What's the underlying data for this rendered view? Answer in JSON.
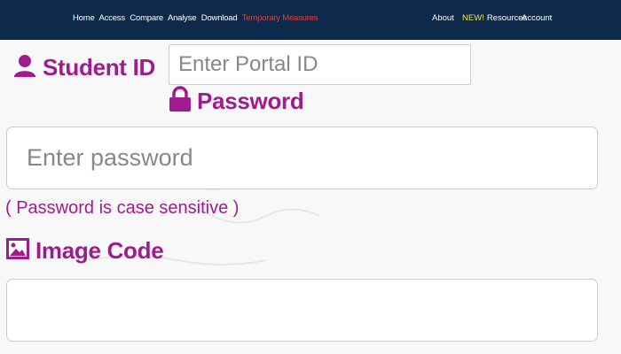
{
  "topbar": {
    "nav_left": [
      "Home",
      "Access",
      "Compare",
      "Analyse",
      "Download"
    ],
    "highlight_link": "Temporary Measures",
    "about": "About",
    "resources_badge": "NEW!",
    "resources": "Resources",
    "account": "Account"
  },
  "form": {
    "student_id_label": "Student ID",
    "student_id_placeholder": "Enter Portal ID",
    "password_label": "Password",
    "password_placeholder": "Enter password",
    "password_hint": "( Password is case sensitive )",
    "image_code_label": "Image Code",
    "image_code_value": ""
  },
  "colors": {
    "navbar": "#0d2a4d",
    "label_purple": "#a01b8e",
    "highlight_red": "#e83b3b",
    "new_badge_yellow": "#f3e64a"
  },
  "icons": {
    "student_id": "user-icon",
    "password": "lock-icon",
    "image_code": "image-icon"
  }
}
